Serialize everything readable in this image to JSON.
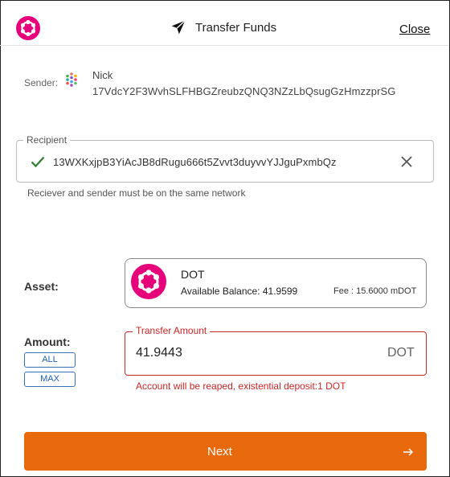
{
  "header": {
    "title": "Transfer Funds",
    "close_label": "Close",
    "logo_icon": "polkadot-logo-icon",
    "send_icon": "paper-plane-icon"
  },
  "sender": {
    "label": "Sender:",
    "name": "Nick",
    "address": "17VdcY2F3WvhSLFHBGZreubzQNQ3NZzLbQsugGzHmzzprSG"
  },
  "recipient": {
    "label": "Recipient",
    "address": "13WXKxjpB3YiAcJB8dRugu666t5Zvvt3duyvvYJJguPxmbQz",
    "helper_text": "Reciever and sender must be on the same network",
    "status_icon": "check-icon"
  },
  "asset": {
    "label": "Asset:",
    "symbol": "DOT",
    "available_balance_label": "Available Balance: 41.9599",
    "fee_label": "Fee : 15.6000 mDOT"
  },
  "amount": {
    "label": "Amount:",
    "all_label": "ALL",
    "max_label": "MAX",
    "field_label": "Transfer Amount",
    "value": "41.9443",
    "unit": "DOT",
    "error_text": "Account will be reaped, existential deposit:1 DOT"
  },
  "footer": {
    "next_label": "Next"
  },
  "colors": {
    "brand_pink": "#e6007a",
    "accent_orange": "#e8680c",
    "error_red": "#c62828",
    "success_green": "#2e7d32",
    "link_blue": "#1d5fae"
  }
}
